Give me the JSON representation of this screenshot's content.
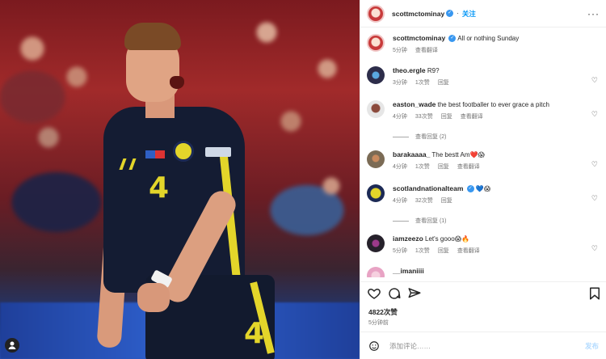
{
  "post": {
    "author": "scottmctominay",
    "follow_label": "关注",
    "caption": "All or nothing Sunday",
    "caption_time": "5分钟",
    "caption_translate": "查看翻译",
    "likes": "4822次赞",
    "time": "5分钟前",
    "comment_placeholder": "添加评论……",
    "post_label": "发布"
  },
  "comments": [
    {
      "user": "theo.ergle",
      "text": "R9?",
      "time": "3分钟",
      "likes": "1次赞",
      "reply": "回复",
      "translate": ""
    },
    {
      "user": "easton_wade",
      "text": "the best footballer to ever grace a pitch",
      "time": "4分钟",
      "likes": "33次赞",
      "reply": "回复",
      "translate": "查看翻译",
      "replies": "查看回复 (2)"
    },
    {
      "user": "barakaaaa_",
      "text": "The bestt Am❤️😱",
      "time": "4分钟",
      "likes": "1次赞",
      "reply": "回复",
      "translate": "查看翻译"
    },
    {
      "user": "scotlandnationalteam",
      "text": "💙😱",
      "time": "4分钟",
      "likes": "32次赞",
      "reply": "回复",
      "translate": "",
      "replies": "查看回复 (1)"
    },
    {
      "user": "iamzeezo",
      "text": "Let's gooo😱🔥",
      "time": "5分钟",
      "likes": "1次赞",
      "reply": "回复",
      "translate": "查看翻译"
    },
    {
      "user": "__imaniiii",
      "text": ""
    }
  ],
  "colors": {
    "accent": "#0095f6",
    "verified": "#3897f0",
    "jersey_yellow": "#e3d52a",
    "jersey_navy": "#141c33"
  },
  "icons": [
    "heart-icon",
    "comment-icon",
    "share-icon",
    "bookmark-icon",
    "emoji-icon",
    "more-icon",
    "verified-icon",
    "user-tag-icon"
  ],
  "jersey": {
    "number": "4"
  }
}
